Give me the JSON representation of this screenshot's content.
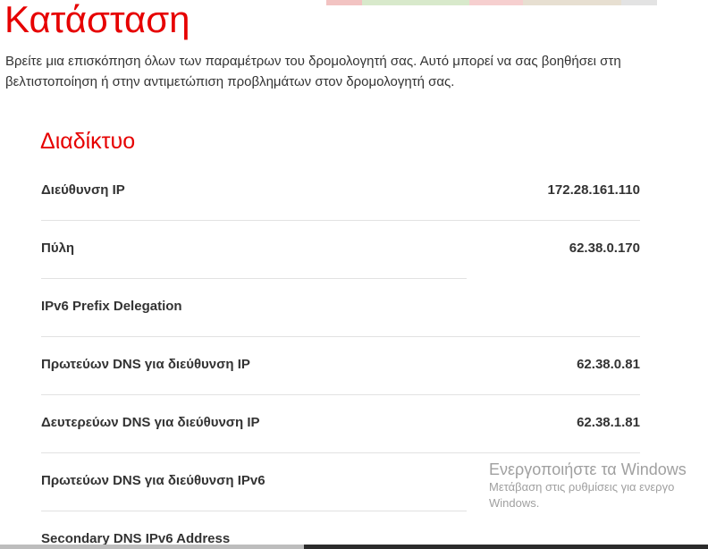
{
  "page": {
    "title": "Κατάσταση",
    "intro": "Βρείτε μια επισκόπηση όλων των παραμέτρων του δρομολογητή σας. Αυτό μπορεί να σας βοηθήσει στη βελτιστοποίηση ή στην αντιμετώπιση προβλημάτων στον δρομολογητή σας."
  },
  "internet": {
    "title": "Διαδίκτυο",
    "rows": [
      {
        "label": "Διεύθυνση IP",
        "value": "172.28.161.110"
      },
      {
        "label": "Πύλη",
        "value": "62.38.0.170"
      },
      {
        "label": "IPv6 Prefix Delegation",
        "value": ""
      },
      {
        "label": "Πρωτεύων DNS για διεύθυνση IP",
        "value": "62.38.0.81"
      },
      {
        "label": "Δευτερεύων DNS για διεύθυνση IP",
        "value": "62.38.1.81"
      },
      {
        "label": "Πρωτεύων DNS για διεύθυνση IPv6",
        "value": ""
      },
      {
        "label": "Secondary DNS IPv6 Address",
        "value": ""
      }
    ]
  },
  "windows_activation": {
    "title": "Ενεργοποιήστε τα Windows",
    "line1": "Μετάβαση στις ρυθμίσεις για ενεργο",
    "line2": "Windows."
  },
  "colors": {
    "accent": "#e60000",
    "text": "#333333",
    "divider": "#e2e2e2",
    "watermark": "#a0a0a0"
  }
}
